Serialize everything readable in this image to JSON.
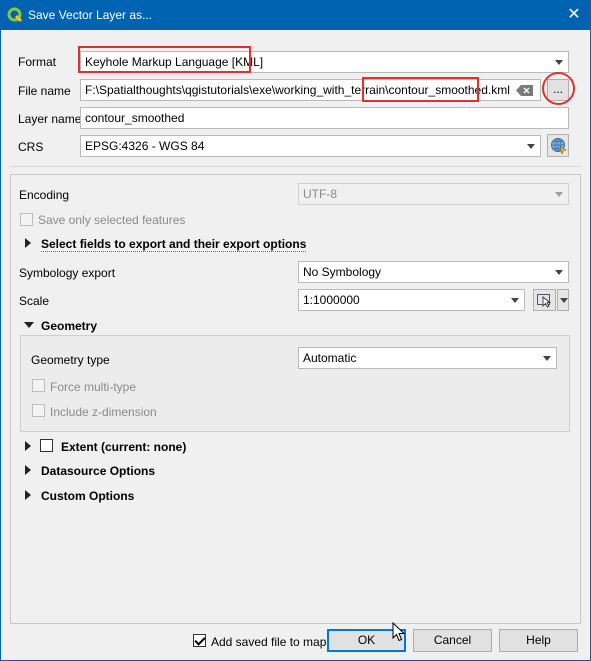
{
  "window": {
    "title": "Save Vector Layer as...",
    "close_glyph": "✕"
  },
  "form": {
    "format_label": "Format",
    "format_value": "Keyhole Markup Language [KML]",
    "filename_label": "File name",
    "filename_path": "F:\\Spatialthoughts\\qgistutorials\\exe\\working_with_terrain\\",
    "filename_file": "contour_smoothed.kml",
    "browse_label": "...",
    "clear_icon": "clear-text-icon",
    "layername_label": "Layer name",
    "layername_value": "contour_smoothed",
    "crs_label": "CRS",
    "crs_value": "EPSG:4326 - WGS 84",
    "crs_icon": "globe-crs-icon"
  },
  "options": {
    "encoding_label": "Encoding",
    "encoding_value": "UTF-8",
    "save_selected_label": "Save only selected features",
    "select_fields_label": "Select fields to export and their export options",
    "symbology_label": "Symbology export",
    "symbology_value": "No Symbology",
    "scale_label": "Scale",
    "scale_value": "1:1000000",
    "geometry_label": "Geometry",
    "geometry_type_label": "Geometry type",
    "geometry_type_value": "Automatic",
    "force_multi_label": "Force multi-type",
    "include_z_label": "Include z-dimension",
    "extent_label": "Extent (current: none)",
    "datasource_label": "Datasource Options",
    "custom_label": "Custom Options"
  },
  "footer": {
    "add_to_map_label": "Add saved file to map",
    "add_to_map_checked": true,
    "ok_label": "OK",
    "cancel_label": "Cancel",
    "help_label": "Help"
  },
  "colors": {
    "titlebar": "#0063b1",
    "highlight": "#e03030"
  }
}
